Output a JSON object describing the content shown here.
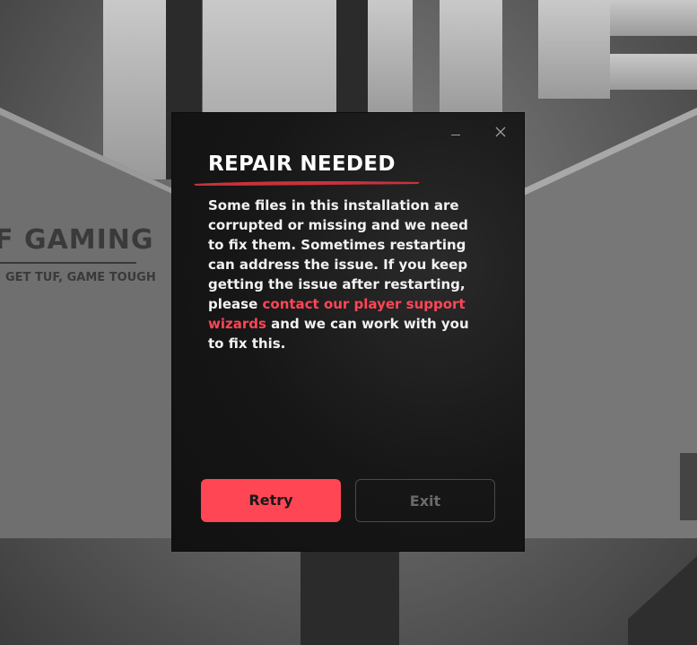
{
  "background": {
    "brand_text": "F GAMING",
    "slogan": "GET TUF, GAME TOUGH"
  },
  "dialog": {
    "title": "REPAIR NEEDED",
    "message_part1": "Some files in this installation are corrupted or missing and we need to fix them. Sometimes restarting can address the issue. If you keep getting the issue after restarting, please ",
    "link_text": "contact our player support wizards",
    "message_part2": " and we can work with you to fix this.",
    "retry_label": "Retry",
    "exit_label": "Exit",
    "minimize_icon": "minimize-icon",
    "close_icon": "close-icon"
  },
  "colors": {
    "accent": "#ff4655",
    "dialog_bg": "#161616",
    "text": "#f2f2f2"
  }
}
